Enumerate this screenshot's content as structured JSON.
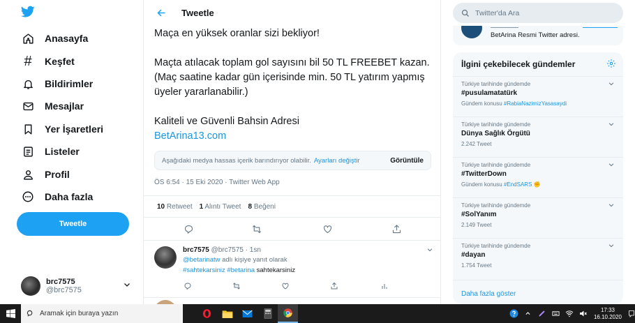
{
  "nav": {
    "items": [
      {
        "label": "Anasayfa",
        "icon": "home-icon"
      },
      {
        "label": "Keşfet",
        "icon": "hashtag-icon"
      },
      {
        "label": "Bildirimler",
        "icon": "bell-icon"
      },
      {
        "label": "Mesajlar",
        "icon": "mail-icon"
      },
      {
        "label": "Yer İşaretleri",
        "icon": "bookmark-icon"
      },
      {
        "label": "Listeler",
        "icon": "list-icon"
      },
      {
        "label": "Profil",
        "icon": "person-icon"
      },
      {
        "label": "Daha fazla",
        "icon": "more-icon"
      }
    ],
    "tweet_button": "Tweetle",
    "account": {
      "name": "brc7575",
      "handle": "@brc7575"
    }
  },
  "header": {
    "title": "Tweetle"
  },
  "tweet": {
    "para1": "Maça en yüksek oranlar sizi bekliyor!",
    "para2": "Maçta atılacak toplam gol sayısını bil 50 TL FREEBET kazan. (Maç saatine kadar gün içerisinde min. 50 TL yatırım yapmış üyeler yararlanabilir.)",
    "para3": "Kaliteli ve Güvenli Bahsin Adresi",
    "link": "BetArina13.com",
    "sensitive": {
      "text": "Aşağıdaki medya hassas içerik barındırıyor olabilir.",
      "settings_link": "Ayarları değiştir",
      "show": "Görüntüle"
    },
    "meta": "ÖS 6:54 · 15 Eki 2020 · Twitter Web App",
    "stats": {
      "retweets": "10",
      "retweets_label": "Retweet",
      "quotes": "1",
      "quotes_label": "Alıntı Tweet",
      "likes": "8",
      "likes_label": "Beğeni"
    }
  },
  "reply": {
    "name": "brc7575",
    "handle": "@brc7575 · 1sn",
    "reply_to": "@betarinatw",
    "reply_to_suffix": "adlı kişiye yanıt olarak",
    "tags": "#sahtekarsiniz #betarina",
    "text": "sahtekarsiniz"
  },
  "search": {
    "placeholder": "Twitter'da Ara"
  },
  "promo": {
    "text": "BetArina Resmi Twitter adresi."
  },
  "trends": {
    "title": "İlgini çekebilecek gündemler",
    "items": [
      {
        "context": "Türkiye tarihinde gündemde",
        "name": "#pusulamatatürk",
        "sub": "Gündem konusu",
        "sub_link": "#RabiaNazimizYasasaydi"
      },
      {
        "context": "Türkiye tarihinde gündemde",
        "name": "Dünya Sağlık Örgütü",
        "sub": "2.242 Tweet",
        "sub_link": ""
      },
      {
        "context": "Türkiye tarihinde gündemde",
        "name": "#TwitterDown",
        "sub": "Gündem konusu",
        "sub_link": "#EndSARS"
      },
      {
        "context": "Türkiye tarihinde gündemde",
        "name": "#SolYanım",
        "sub": "2.149 Tweet",
        "sub_link": ""
      },
      {
        "context": "Türkiye tarihinde gündemde",
        "name": "#dayan",
        "sub": "1.754 Tweet",
        "sub_link": ""
      }
    ],
    "more": "Daha fazla göster"
  },
  "taskbar": {
    "search_placeholder": "Aramak için buraya yazın",
    "time": "17:33",
    "date": "16.10.2020"
  },
  "colors": {
    "accent": "#1da1f2",
    "link": "#1b95e0",
    "muted": "#657786"
  }
}
